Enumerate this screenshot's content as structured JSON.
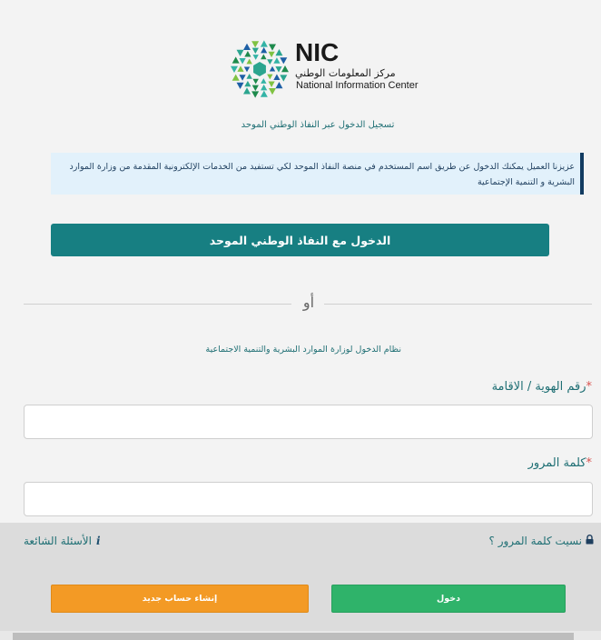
{
  "logo": {
    "abbr": "NIC",
    "arabic_name": "مركز المعلومات الوطني",
    "english_name": "National Information Center",
    "colors": [
      "#1e8a4c",
      "#2ba58f",
      "#1d5fa5",
      "#7fc242",
      "#33b3a6"
    ]
  },
  "subtitle": "تسجيل الدخول عبر النفاذ الوطني الموحد",
  "notice": {
    "text": "عزيزنا العميل يمكنك الدخول عن طريق اسم المستخدم في منصة النفاذ الموحد لكي تستفيد من الخدمات الإلكترونية المقدمة من وزارة الموارد البشرية و التنمية الإجتماعية"
  },
  "nafath_button": {
    "label": "الدخول مع النفاذ الوطني الموحد"
  },
  "divider": {
    "or_label": "أو"
  },
  "system_title": "نظام الدخول لوزارة الموارد البشرية والتنمية الاجتماعية",
  "id_field": {
    "label": "رقم الهوية / الاقامة",
    "required_mark": "*",
    "value": "",
    "placeholder": ""
  },
  "password_field": {
    "label": "كلمة المرور",
    "required_mark": "*",
    "value": "",
    "placeholder": ""
  },
  "links": {
    "forgot_password": "نسيت كلمة المرور ؟",
    "faq": "الأسئلة الشائعة"
  },
  "buttons": {
    "register": "إنشاء حساب جديد",
    "login": "دخول"
  },
  "colors": {
    "teal": "#177f82",
    "orange": "#f39a25",
    "green": "#2fb36a",
    "notice_bg": "#e2f1fb",
    "notice_border": "#123b61"
  }
}
